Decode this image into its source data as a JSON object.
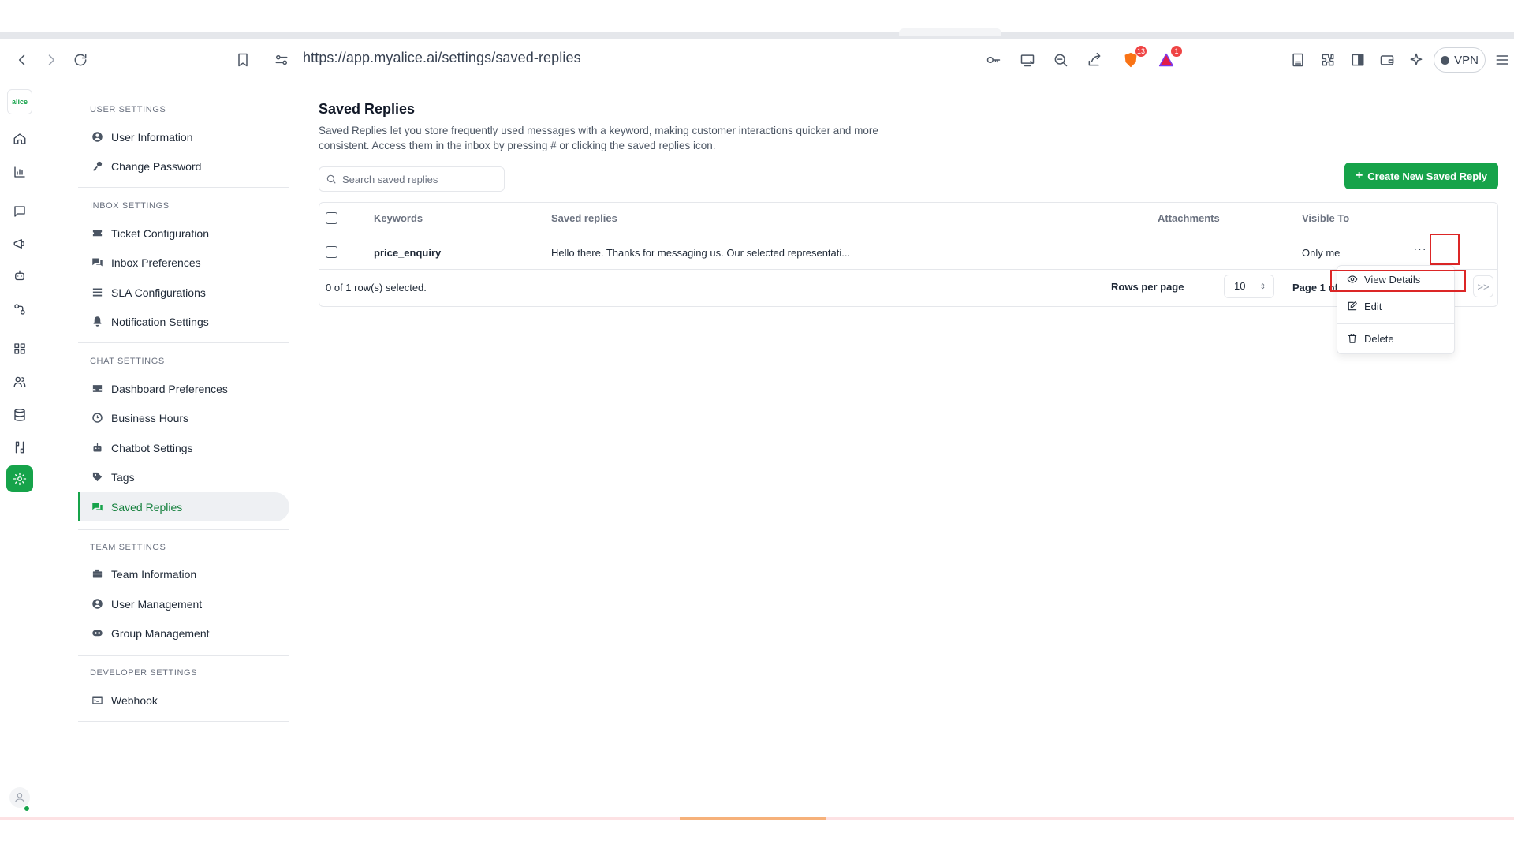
{
  "browser": {
    "url": "https://app.myalice.ai/settings/saved-replies",
    "brave_badge": "13",
    "alert_badge": "1",
    "vpn_label": "VPN"
  },
  "rail": {
    "logo_text": "alice",
    "icons": [
      "home-icon",
      "analytics-icon",
      "inbox-icon",
      "broadcast-icon",
      "bot-icon",
      "integrations-icon",
      "apps-icon",
      "customers-icon",
      "data-icon",
      "workflow-icon",
      "settings-icon"
    ]
  },
  "sidebar": {
    "sections": [
      {
        "title": "USER SETTINGS",
        "items": [
          {
            "label": "User Information",
            "icon": "user-circle-icon"
          },
          {
            "label": "Change Password",
            "icon": "key-icon"
          }
        ]
      },
      {
        "title": "INBOX SETTINGS",
        "items": [
          {
            "label": "Ticket Configuration",
            "icon": "ticket-icon"
          },
          {
            "label": "Inbox Preferences",
            "icon": "chat-bubbles-icon"
          },
          {
            "label": "SLA Configurations",
            "icon": "list-icon"
          },
          {
            "label": "Notification Settings",
            "icon": "bell-icon"
          }
        ]
      },
      {
        "title": "CHAT SETTINGS",
        "items": [
          {
            "label": "Dashboard Preferences",
            "icon": "inbox-tray-icon"
          },
          {
            "label": "Business Hours",
            "icon": "clock-icon"
          },
          {
            "label": "Chatbot Settings",
            "icon": "robot-icon"
          },
          {
            "label": "Tags",
            "icon": "tag-icon"
          },
          {
            "label": "Saved Replies",
            "icon": "saved-replies-icon",
            "active": true
          }
        ]
      },
      {
        "title": "TEAM SETTINGS",
        "items": [
          {
            "label": "Team Information",
            "icon": "team-icon"
          },
          {
            "label": "User Management",
            "icon": "user-circle-icon"
          },
          {
            "label": "Group Management",
            "icon": "group-icon"
          }
        ]
      },
      {
        "title": "DEVELOPER SETTINGS",
        "items": [
          {
            "label": "Webhook",
            "icon": "terminal-icon"
          }
        ]
      }
    ]
  },
  "main": {
    "title": "Saved Replies",
    "description": "Saved Replies let you store frequently used messages with a keyword, making customer interactions quicker and more consistent. Access them in the inbox by pressing # or clicking the saved replies icon.",
    "search_placeholder": "Search saved replies",
    "create_button": "Create New Saved Reply",
    "table": {
      "headers": {
        "keywords": "Keywords",
        "saved_replies": "Saved replies",
        "attachments": "Attachments",
        "visible_to": "Visible To"
      },
      "rows": [
        {
          "keyword": "price_enquiry",
          "reply": "Hello there. Thanks for messaging us. Our selected representati...",
          "attachments": "",
          "visible_to": "Only me",
          "more": "···"
        }
      ],
      "selected_text": "0 of 1 row(s) selected.",
      "rows_per_page_label": "Rows per page",
      "rows_per_page_value": "10",
      "page_text": "Page 1 of",
      "next_label": ">>"
    },
    "row_menu": {
      "items": [
        {
          "label": "View Details",
          "icon": "eye-icon"
        },
        {
          "label": "Edit",
          "icon": "edit-icon"
        },
        {
          "label": "Delete",
          "icon": "trash-icon"
        }
      ]
    }
  },
  "colors": {
    "accent": "#16a34a",
    "highlight": "#dc2626"
  }
}
